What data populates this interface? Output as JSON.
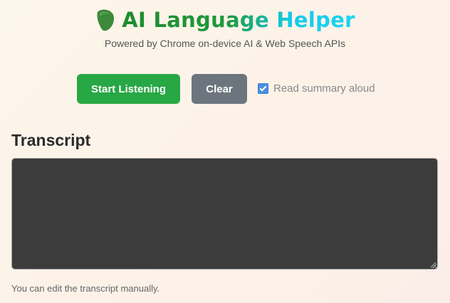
{
  "header": {
    "logo_icon": "leaf-icon",
    "title": "AI Language Helper",
    "subtitle": "Powered by Chrome on-device AI & Web Speech APIs",
    "title_gradient": [
      "#1f8b2e",
      "#14c9e8"
    ]
  },
  "controls": {
    "start_label": "Start Listening",
    "start_color": "#28a745",
    "clear_label": "Clear",
    "clear_color": "#6c757d",
    "read_aloud_label": "Read summary aloud",
    "read_aloud_checked": true
  },
  "transcript": {
    "heading": "Transcript",
    "value": "",
    "background": "#3c3c3c",
    "hint": "You can edit the transcript manually."
  }
}
